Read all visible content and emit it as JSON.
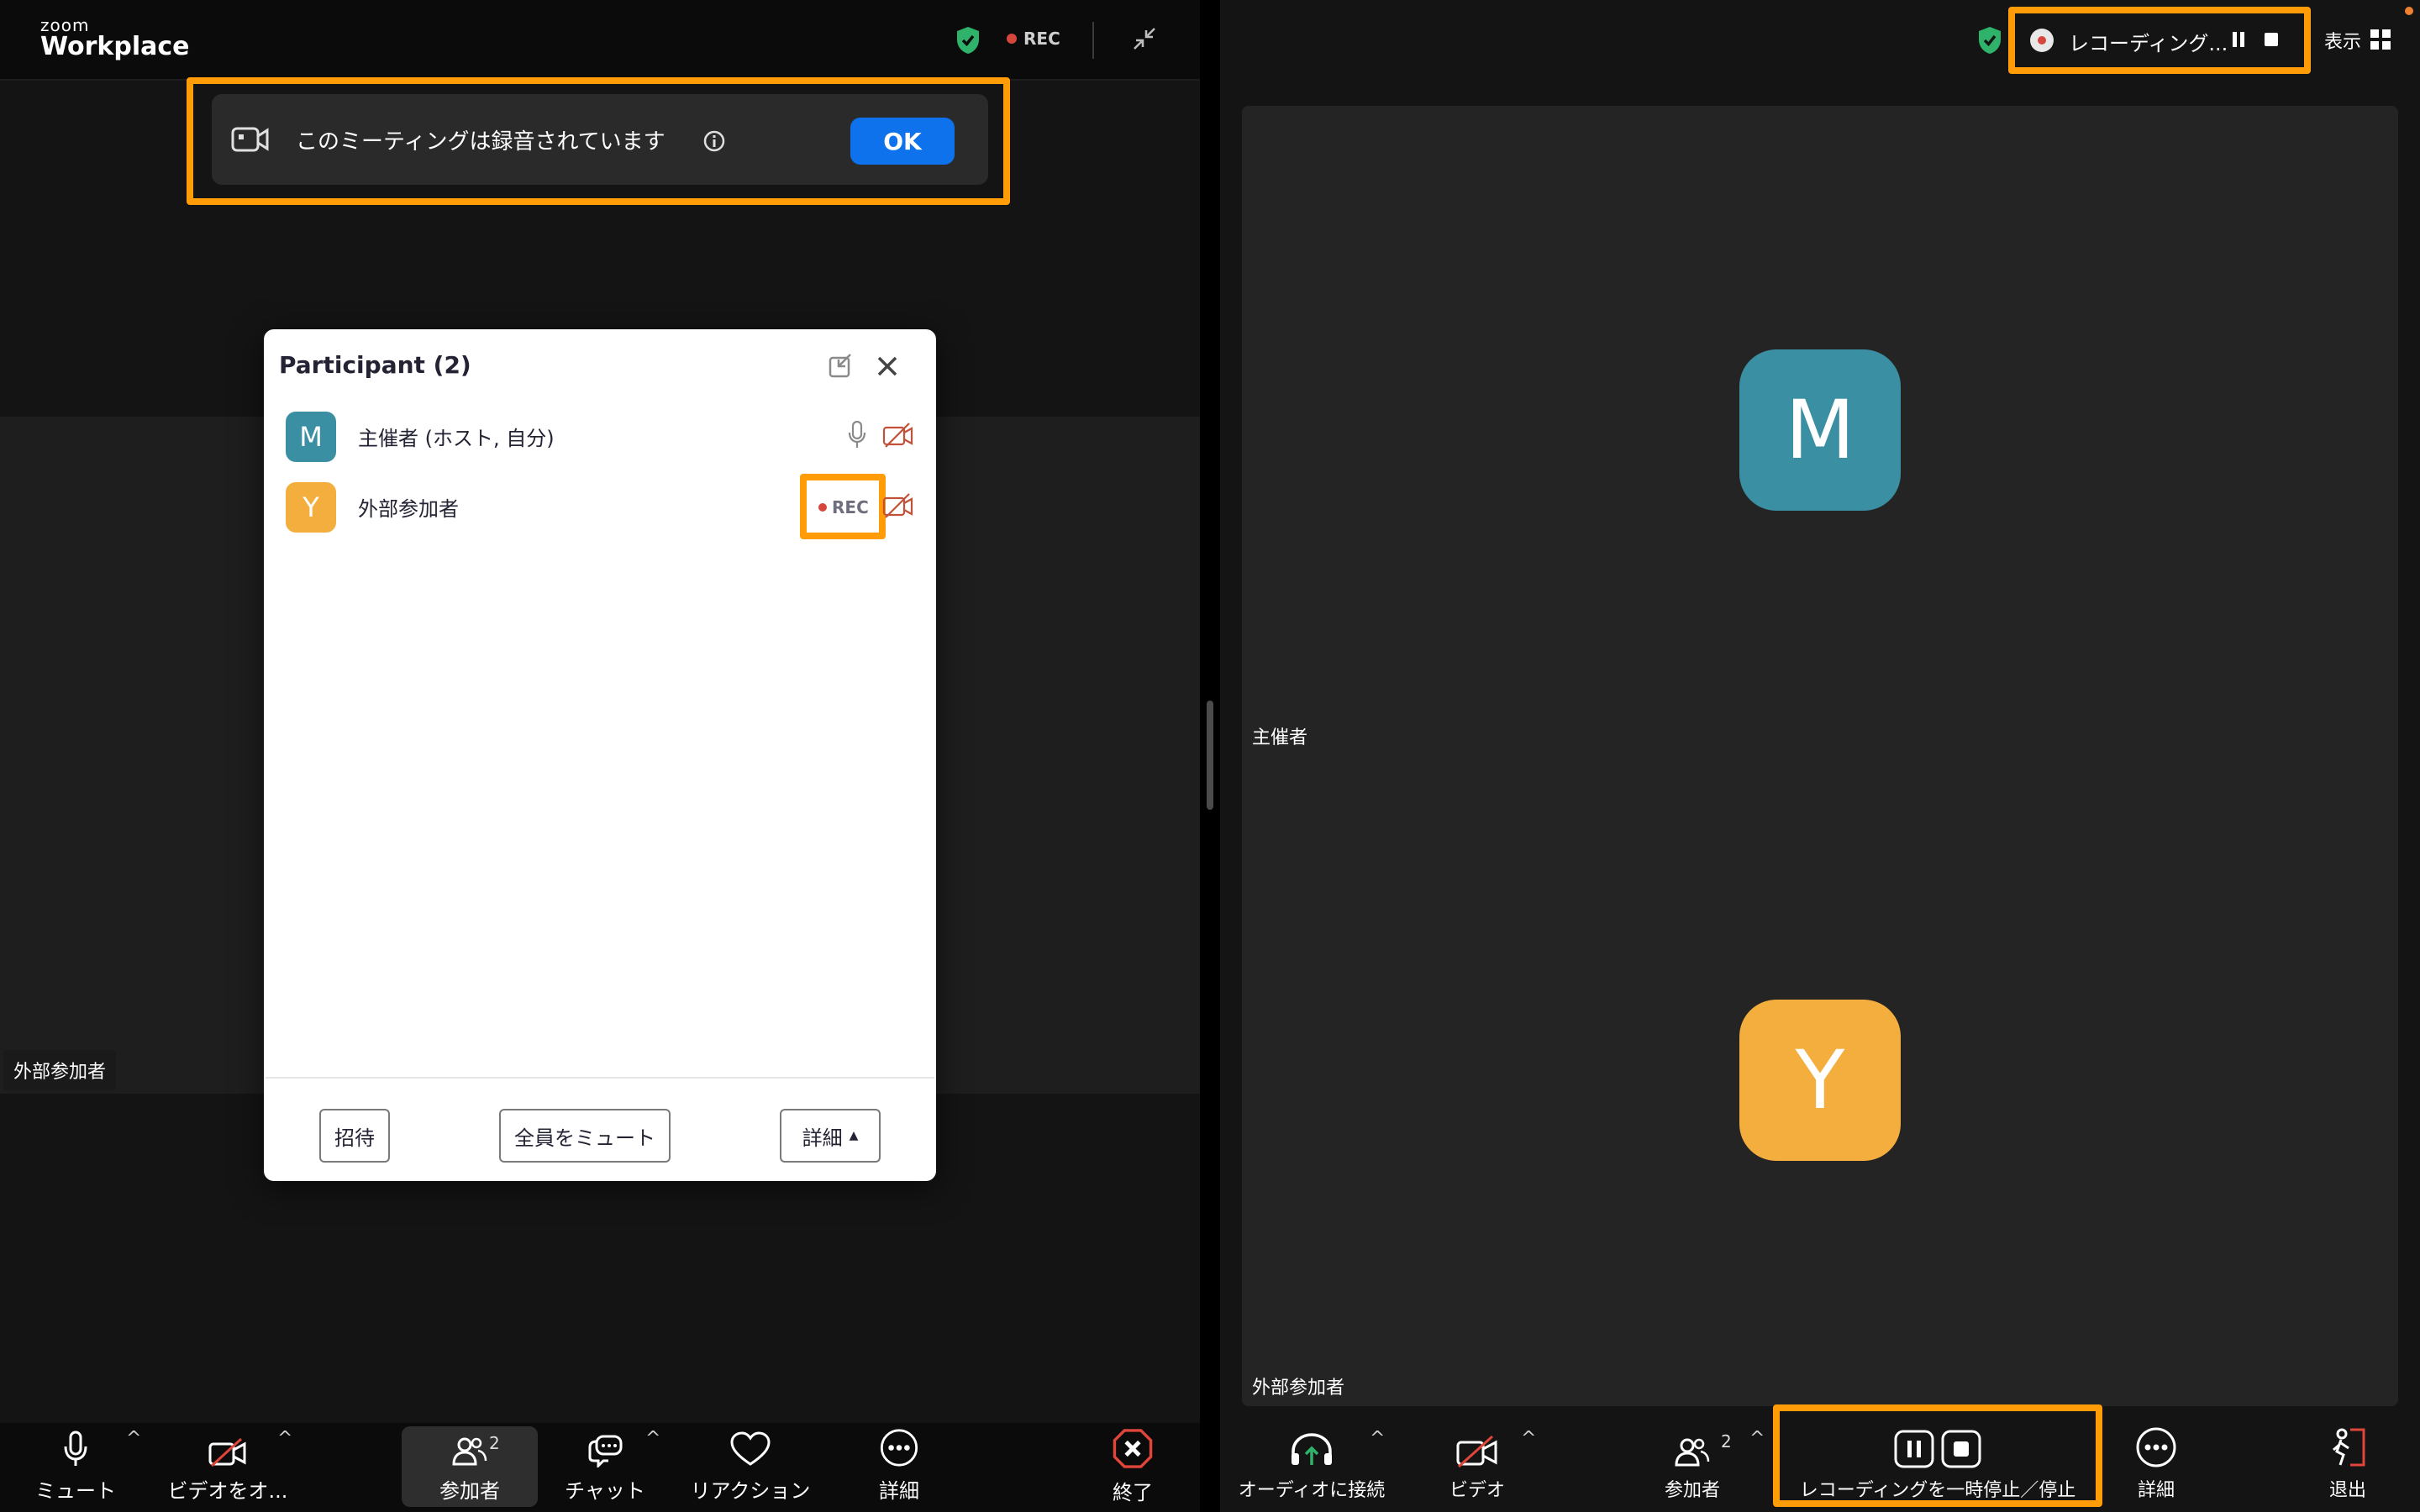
{
  "left": {
    "logo_top": "zoom",
    "logo_main": "Workplace",
    "top_rec_label": "REC",
    "notice": {
      "text": "このミーティングは録音されています",
      "ok_label": "OK"
    },
    "video_name": "外部参加者",
    "panel": {
      "title": "Participant (2)",
      "participants": [
        {
          "initial": "M",
          "name": "主催者 (ホスト, 自分)",
          "color": "#3b8fa3"
        },
        {
          "initial": "Y",
          "name": "外部参加者",
          "color": "#f3ae3e",
          "status": "REC"
        }
      ],
      "invite_label": "招待",
      "mute_all_label": "全員をミュート",
      "more_label": "詳細"
    },
    "toolbar": {
      "mute": "ミュート",
      "video": "ビデオをオ...",
      "participants": "参加者",
      "participants_count": "2",
      "chat": "チャット",
      "reactions": "リアクション",
      "more": "詳細",
      "end": "終了"
    }
  },
  "right": {
    "recording_label": "レコーディング...",
    "view_label": "表示",
    "host_name": "主催者",
    "guest_name": "外部参加者",
    "host_initial": "M",
    "guest_initial": "Y",
    "host_color": "#3b8fa3",
    "guest_color": "#f3ae3e",
    "toolbar": {
      "audio": "オーディオに接続",
      "video": "ビデオ",
      "participants": "参加者",
      "participants_count": "2",
      "recording": "レコーディングを一時停止／停止",
      "more": "詳細",
      "leave": "退出"
    }
  },
  "colors": {
    "highlight": "#ff9c07",
    "accent": "#0e72ed",
    "rec": "#d6473b"
  }
}
